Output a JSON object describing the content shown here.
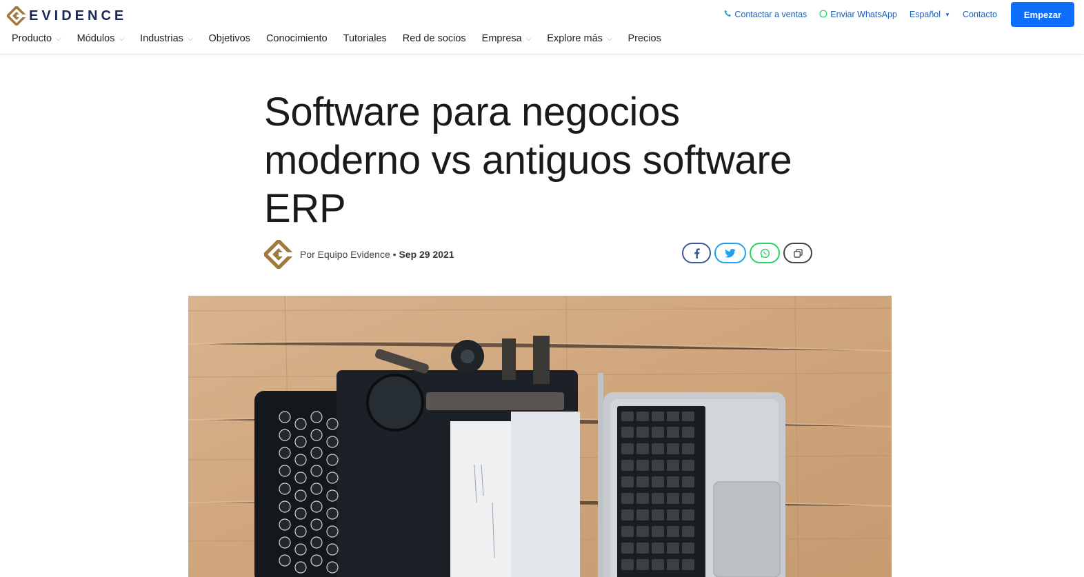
{
  "brand": {
    "name": "EVIDENCE"
  },
  "topbar": {
    "contact_sales": "Contactar a ventas",
    "whatsapp": "Enviar WhatsApp",
    "language": "Español",
    "contact": "Contacto",
    "cta": "Empezar"
  },
  "nav": {
    "items": [
      {
        "label": "Producto",
        "dropdown": true
      },
      {
        "label": "Módulos",
        "dropdown": true
      },
      {
        "label": "Industrias",
        "dropdown": true
      },
      {
        "label": "Objetivos",
        "dropdown": false
      },
      {
        "label": "Conocimiento",
        "dropdown": false
      },
      {
        "label": "Tutoriales",
        "dropdown": false
      },
      {
        "label": "Red de socios",
        "dropdown": false
      },
      {
        "label": "Empresa",
        "dropdown": true
      },
      {
        "label": "Explore más",
        "dropdown": true
      },
      {
        "label": "Precios",
        "dropdown": false
      }
    ]
  },
  "article": {
    "title": "Software para negocios moderno vs antiguos software ERP",
    "author": "Por Equipo Evidence",
    "separator": "•",
    "date": "Sep 29 2021"
  },
  "share": {
    "icons": [
      "facebook-icon",
      "twitter-icon",
      "whatsapp-icon",
      "copy-link-icon"
    ]
  },
  "colors": {
    "brand_gold": "#a07a3c",
    "brand_navy": "#1b2a55",
    "link_blue": "#1e5eb8",
    "cta_blue": "#0d6efd",
    "facebook": "#3b5998",
    "twitter": "#1da1f2",
    "whatsapp": "#25d366"
  }
}
